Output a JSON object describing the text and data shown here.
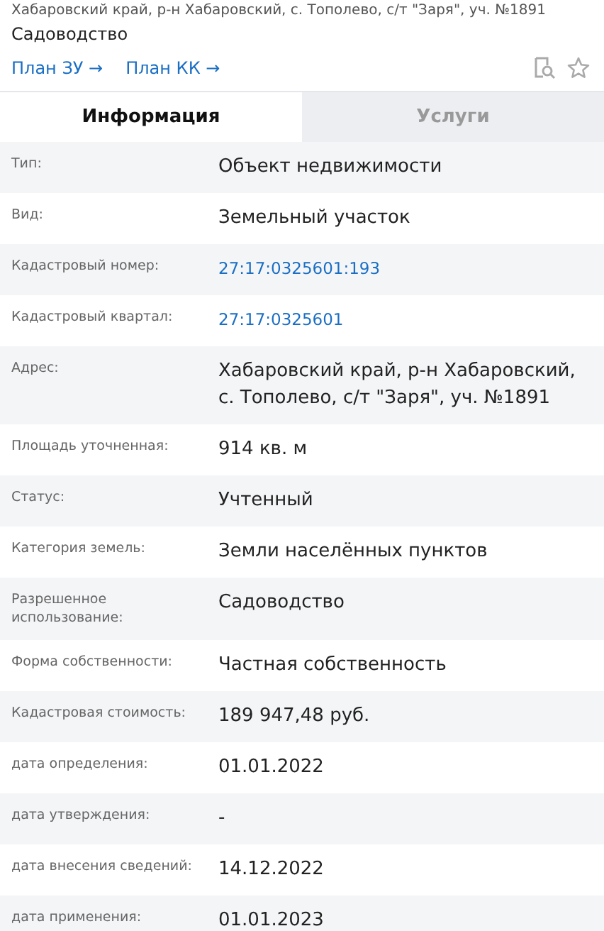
{
  "header": {
    "address": "Хабаровский край, р-н Хабаровский, с. Тополево, с/т \"Заря\", уч. №1891",
    "subtitle": "Садоводство",
    "links": [
      "План ЗУ →",
      "План КК →"
    ]
  },
  "tabs": [
    {
      "label": "Информация",
      "selected": true
    },
    {
      "label": "Услуги",
      "selected": false
    }
  ],
  "rows": [
    {
      "label": "Тип:",
      "value": "Объект недвижимости",
      "kind": "text"
    },
    {
      "label": "Вид:",
      "value": "Земельный участок",
      "kind": "text"
    },
    {
      "label": "Кадастровый номер:",
      "value": "27:17:0325601:193",
      "kind": "link"
    },
    {
      "label": "Кадастровый квартал:",
      "value": "27:17:0325601",
      "kind": "link"
    },
    {
      "label": "Адрес:",
      "value": "Хабаровский край, р-н Хабаровский, с. Тополево, с/т \"Заря\", уч. №1891",
      "kind": "text"
    },
    {
      "label": "Площадь уточненная:",
      "value": "914 кв. м",
      "kind": "text"
    },
    {
      "label": "Статус:",
      "value": "Учтенный",
      "kind": "text"
    },
    {
      "label": "Категория земель:",
      "value": "Земли населённых пунктов",
      "kind": "text"
    },
    {
      "label": "Разрешенное использование:",
      "value": "Садоводство",
      "kind": "text"
    },
    {
      "label": "Форма собственности:",
      "value": "Частная собственность",
      "kind": "text"
    },
    {
      "label": "Кадастровая стоимость:",
      "value": "189 947,48 руб.",
      "kind": "text"
    },
    {
      "label": "дата определения:",
      "value": "01.01.2022",
      "kind": "text"
    },
    {
      "label": "дата утверждения:",
      "value": "-",
      "kind": "text"
    },
    {
      "label": "дата внесения сведений:",
      "value": "14.12.2022",
      "kind": "text"
    },
    {
      "label": "дата применения:",
      "value": "01.01.2023",
      "kind": "text"
    }
  ]
}
